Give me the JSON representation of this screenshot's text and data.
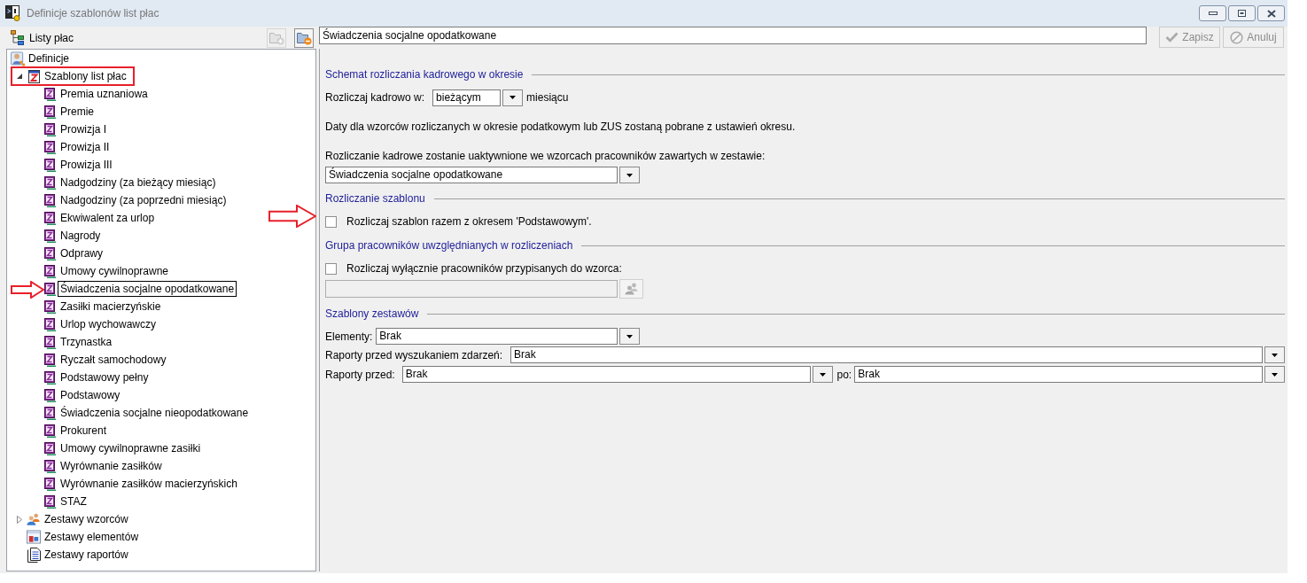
{
  "window": {
    "title": "Definicje szablonów list płac"
  },
  "left_panel": {
    "title": "Listy płac",
    "tools": [
      {
        "kind": "add",
        "disabled": true
      },
      {
        "kind": "remove",
        "disabled": false
      }
    ]
  },
  "tree": [
    {
      "label": "Definicje",
      "kind": "root",
      "selected": false,
      "children": [
        {
          "label": "Szablony list płac",
          "kind": "group",
          "expanded": true,
          "selected": false,
          "framed": true,
          "children": [
            {
              "label": "Premia uznaniowa",
              "kind": "template",
              "selected": false
            },
            {
              "label": "Premie",
              "kind": "template",
              "selected": false
            },
            {
              "label": "Prowizja I",
              "kind": "template",
              "selected": false
            },
            {
              "label": "Prowizja II",
              "kind": "template",
              "selected": false
            },
            {
              "label": "Prowizja III",
              "kind": "template",
              "selected": false
            },
            {
              "label": "Nadgodziny (za bieżący miesiąc)",
              "kind": "template",
              "selected": false
            },
            {
              "label": "Nadgodziny (za poprzedni miesiąc)",
              "kind": "template",
              "selected": false
            },
            {
              "label": "Ekwiwalent za urlop",
              "kind": "template",
              "selected": false
            },
            {
              "label": "Nagrody",
              "kind": "template",
              "selected": false
            },
            {
              "label": "Odprawy",
              "kind": "template",
              "selected": false
            },
            {
              "label": "Umowy cywilnoprawne",
              "kind": "template",
              "selected": false
            },
            {
              "label": "Świadczenia socjalne opodatkowane",
              "kind": "template",
              "selected": true,
              "pointed": true
            },
            {
              "label": "Zasiłki macierzyńskie",
              "kind": "template",
              "selected": false
            },
            {
              "label": "Urlop wychowawczy",
              "kind": "template",
              "selected": false
            },
            {
              "label": "Trzynastka",
              "kind": "template",
              "selected": false
            },
            {
              "label": "Ryczałt samochodowy",
              "kind": "template",
              "selected": false
            },
            {
              "label": "Podstawowy pełny",
              "kind": "template",
              "selected": false
            },
            {
              "label": "Podstawowy",
              "kind": "template",
              "selected": false
            },
            {
              "label": "Świadczenia socjalne nieopodatkowane",
              "kind": "template",
              "selected": false
            },
            {
              "label": "Prokurent",
              "kind": "template",
              "selected": false
            },
            {
              "label": "Umowy cywilnoprawne zasiłki",
              "kind": "template",
              "selected": false
            },
            {
              "label": "Wyrównanie zasiłków",
              "kind": "template",
              "selected": false
            },
            {
              "label": "Wyrównanie zasiłków macierzyńskich",
              "kind": "template",
              "selected": false
            },
            {
              "label": "STAZ",
              "kind": "template",
              "selected": false
            }
          ]
        },
        {
          "label": "Zestawy wzorców",
          "kind": "pattern-set",
          "expanded": false,
          "selected": false
        },
        {
          "label": "Zestawy elementów",
          "kind": "element-set",
          "selected": false
        },
        {
          "label": "Zestawy raportów",
          "kind": "report-set",
          "selected": false
        }
      ]
    }
  ],
  "editor": {
    "name_field": {
      "value": "Świadczenia socjalne opodatkowane"
    },
    "buttons": [
      {
        "label": "Zapisz",
        "kind": "save",
        "disabled": true
      },
      {
        "label": "Anuluj",
        "kind": "cancel",
        "disabled": true
      }
    ],
    "sections": [
      {
        "title": "Schemat rozliczania kadrowego w okresie",
        "rows": [
          {
            "kind": "inline-combo",
            "label": "Rozliczaj kadrowo w:",
            "value": "bieżącym",
            "suffix": "miesiącu"
          },
          {
            "kind": "note",
            "text": "Daty dla wzorców rozliczanych w okresie podatkowym lub ZUS zostaną pobrane z ustawień okresu."
          },
          {
            "kind": "note",
            "text": "Rozliczanie kadrowe zostanie uaktywnione we wzorcach pracowników zawartych w zestawie:"
          },
          {
            "kind": "combo",
            "value": "Świadczenia socjalne opodatkowane"
          }
        ]
      },
      {
        "title": "Rozliczanie szablonu",
        "rows": [
          {
            "kind": "checkbox",
            "label": "Rozliczaj szablon razem z okresem 'Podstawowym'.",
            "checked": false,
            "pointed": true
          }
        ]
      },
      {
        "title": "Grupa pracowników uwzględnianych w rozliczeniach",
        "rows": [
          {
            "kind": "checkbox",
            "label": "Rozliczaj wyłącznie pracowników przypisanych do wzorca:",
            "checked": false
          },
          {
            "kind": "picker",
            "disabled": true
          }
        ]
      },
      {
        "title": "Szablony zestawów",
        "rows": [
          {
            "kind": "combo",
            "label": "Elementy:",
            "value": "Brak"
          },
          {
            "kind": "wide-combo",
            "label": "Raporty przed wyszukaniem zdarzeń:",
            "value": "Brak"
          },
          {
            "kind": "combo-pair",
            "items": [
              {
                "label": "Raporty przed:",
                "value": "Brak"
              },
              {
                "label": "po:",
                "value": "Brak"
              }
            ]
          }
        ]
      }
    ]
  }
}
